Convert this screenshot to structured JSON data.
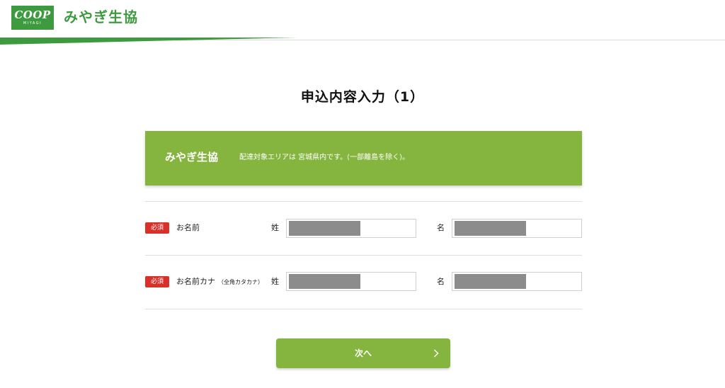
{
  "header": {
    "logo_main": "COOP",
    "logo_sub": "MIYAGI",
    "brand_name": "みやぎ生協",
    "colors": {
      "brand_green": "#3e9a3f",
      "accent_green": "#85b53f"
    }
  },
  "page": {
    "title": "申込内容入力（1）"
  },
  "banner": {
    "name": "みやぎ生協",
    "text": "配達対象エリアは 宮城県内です。(一部離島を除く)。"
  },
  "form": {
    "rows": [
      {
        "required_badge": "必須",
        "label": "お名前",
        "label_note": "",
        "last_label": "姓",
        "first_label": "名"
      },
      {
        "required_badge": "必須",
        "label": "お名前カナ",
        "label_note": "（全角カタカナ）",
        "last_label": "姓",
        "first_label": "名"
      }
    ]
  },
  "actions": {
    "next_label": "次へ",
    "next_icon": "chevron-right-icon"
  }
}
